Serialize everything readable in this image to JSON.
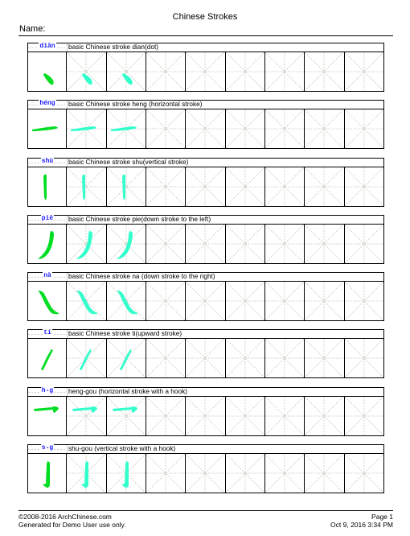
{
  "document": {
    "title": "Chinese Strokes",
    "name_label": "Name:"
  },
  "colors": {
    "model_stroke": "#00dd22",
    "trace_stroke": "#33ffcc",
    "pinyin": "#1a1aff",
    "guide_lines": "#c8c8c0"
  },
  "grid": {
    "cells_per_row": 9,
    "trace_cells": 2
  },
  "strokes": [
    {
      "pinyin": "diǎn",
      "description": "basic Chinese stroke dian(dot)",
      "stroke": "dian"
    },
    {
      "pinyin": "héng",
      "description": "basic Chinese stroke heng (horizontal stroke)",
      "stroke": "heng"
    },
    {
      "pinyin": "shù",
      "description": "basic Chinese stroke shu(vertical stroke)",
      "stroke": "shu"
    },
    {
      "pinyin": "piě",
      "description": "basic Chinese stroke pie(down stroke to the left)",
      "stroke": "pie"
    },
    {
      "pinyin": "nà",
      "description": "basic Chinese stroke na (down stroke to the right)",
      "stroke": "na"
    },
    {
      "pinyin": "tí",
      "description": "basic Chinese stroke ti(upward stroke)",
      "stroke": "ti"
    },
    {
      "pinyin": "h-g",
      "description": "heng-gou (horizontal stroke with a hook)",
      "stroke": "henggou"
    },
    {
      "pinyin": "s-g",
      "description": "shu-gou (vertical stroke with a hook)",
      "stroke": "shugou"
    }
  ],
  "footer": {
    "copyright": "©2008-2016 ArchChinese.com",
    "generated": "Generated for Demo User use only.",
    "page": "Page 1",
    "date": "Oct 9, 2016 3:34 PM"
  }
}
